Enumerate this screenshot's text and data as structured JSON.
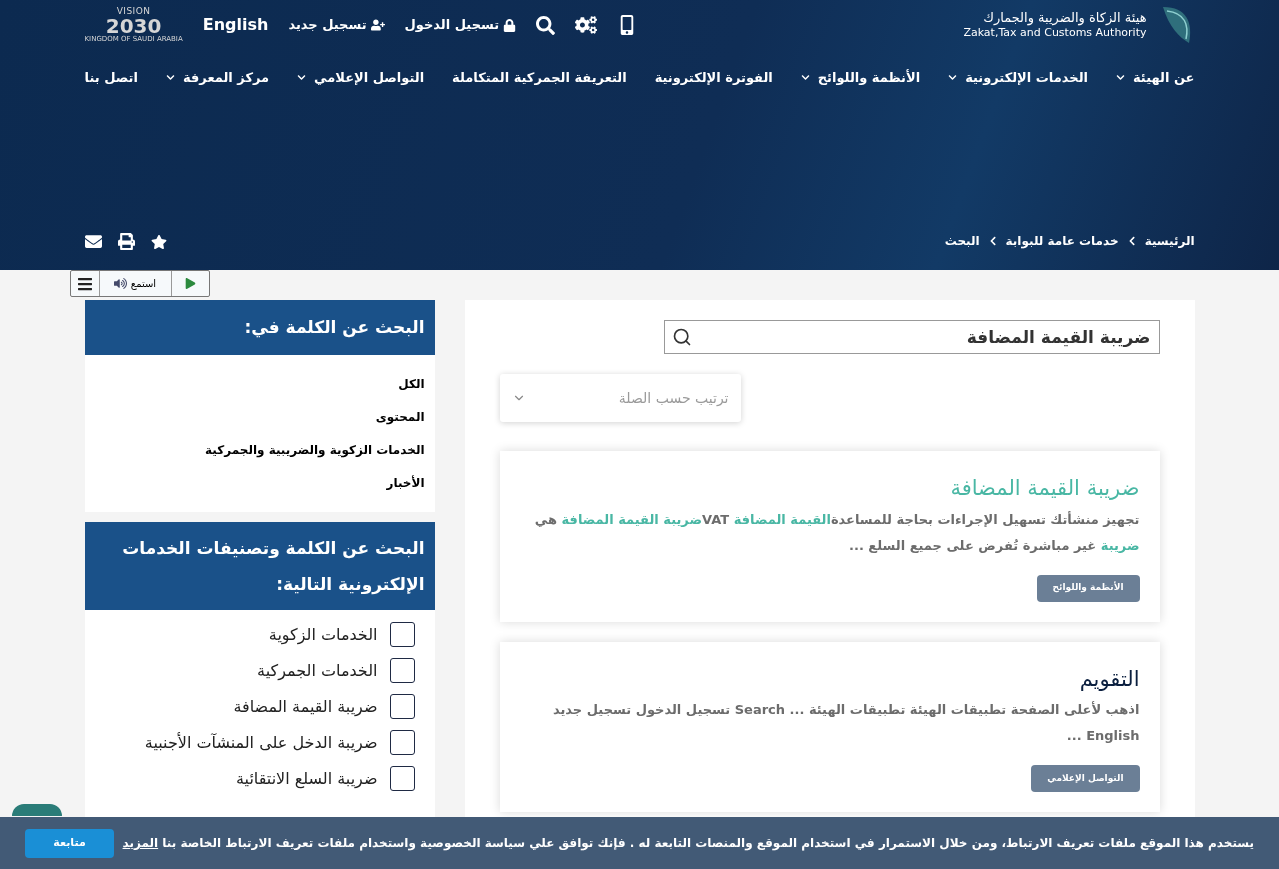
{
  "header": {
    "org_name_ar": "هيئة الزكاة والضريبة والجمارك",
    "org_name_en": "Zakat,Tax and Customs Authority",
    "login": "تسجيل الدخول",
    "register": "تسجيل جديد",
    "language": "English",
    "vision": {
      "word": "VISION",
      "year": "2030",
      "country": "KINGDOM OF SAUDI ARABIA"
    }
  },
  "nav": [
    {
      "label": "عن الهيئة",
      "dropdown": true
    },
    {
      "label": "الخدمات الإلكترونية",
      "dropdown": true
    },
    {
      "label": "الأنظمة واللوائح",
      "dropdown": true
    },
    {
      "label": "الفوترة الإلكترونية",
      "dropdown": false
    },
    {
      "label": "التعريفة الجمركية المتكاملة",
      "dropdown": false
    },
    {
      "label": "التواصل الإعلامي",
      "dropdown": true
    },
    {
      "label": "مركز المعرفة",
      "dropdown": true
    },
    {
      "label": "اتصل بنا",
      "dropdown": false
    }
  ],
  "breadcrumb": [
    "الرئيسية",
    "خدمات عامة للبوابة",
    "البحث"
  ],
  "listen": {
    "label": "استمع"
  },
  "search": {
    "value": "ضريبة القيمة المضافة"
  },
  "sort": {
    "placeholder": "ترتيب حسب الصلة"
  },
  "results": [
    {
      "title": "ضريبة القيمة المضافة",
      "title_highlight": true,
      "snippet": [
        {
          "text": "تجهيز منشأتك تسهيل الإجراءات بحاجة للمساعدة",
          "highlight": false
        },
        {
          "text": "القيمة المضافة",
          "highlight": true
        },
        {
          "text": " VAT",
          "highlight": false
        },
        {
          "text": "ضريبة القيمة المضافة",
          "highlight": true
        },
        {
          "text": " هي ",
          "highlight": false
        },
        {
          "text": "ضريبة",
          "highlight": true
        },
        {
          "text": " غير مباشرة تُفرض على جميع السلع ...",
          "highlight": false
        }
      ],
      "tag": "الأنظمة واللوائح"
    },
    {
      "title": "التقويم",
      "title_highlight": false,
      "snippet": [
        {
          "text": "اذهب لأعلى الصفحة تطبيقات الهيئة تطبيقات الهيئة ... Search تسجيل الدخول تسجيل جديد English ...",
          "highlight": false
        }
      ],
      "tag": "التواصل الإعلامي"
    }
  ],
  "scope_panel": {
    "title": "البحث عن الكلمة في:",
    "items": [
      "الكل",
      "المحتوى",
      "الخدمات الزكوية والضريبية والجمركية",
      "الأخبار"
    ]
  },
  "category_panel": {
    "title": "البحث عن الكلمة وتصنيفات الخدمات الإلكترونية التالية:",
    "items": [
      {
        "label": "الخدمات الزكوية",
        "checked": false
      },
      {
        "label": "الخدمات الجمركية",
        "checked": false
      },
      {
        "label": "ضريبة القيمة المضافة",
        "checked": false
      },
      {
        "label": "ضريبة الدخل على المنشآت الأجنبية",
        "checked": false
      },
      {
        "label": "ضريبة السلع الانتقائية",
        "checked": false
      }
    ]
  },
  "cookie_bar": {
    "text": "يستخدم هذا الموقع ملفات تعريف الارتباط، ومن خلال الاستمرار في استخدام الموقع والمنصات التابعة له . فإنك توافق علي سياسة الخصوصية واستخدام ملفات تعريف الارتباط الخاصة بنا",
    "link": "المزيد",
    "button": "متابعة"
  }
}
